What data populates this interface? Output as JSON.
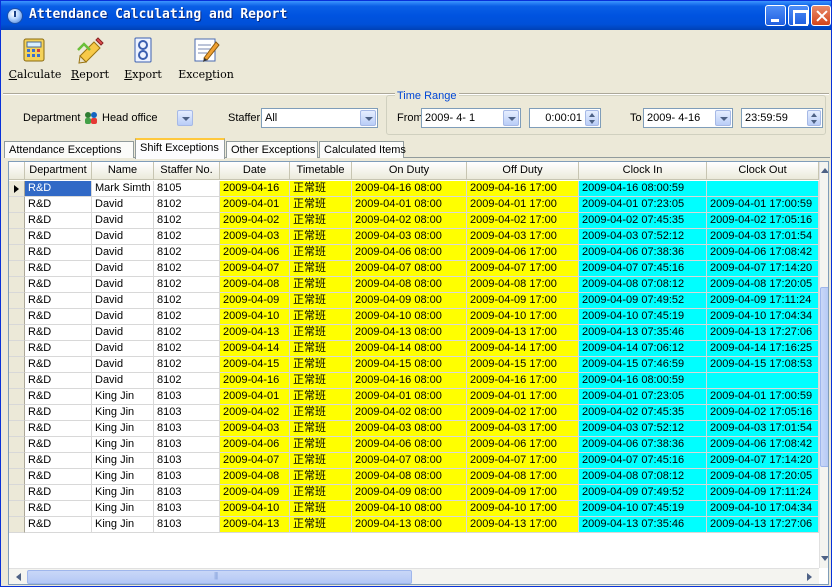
{
  "window": {
    "title": "Attendance Calculating and Report",
    "controls": [
      "minimize-icon",
      "maximize-icon",
      "close-icon"
    ]
  },
  "toolbar": {
    "calculate": {
      "label": "Calculate",
      "accel": "C",
      "rest": "alculate",
      "icon": "calculator-icon"
    },
    "report": {
      "label": "Report",
      "accel": "R",
      "rest": "eport",
      "icon": "report-icon"
    },
    "export": {
      "label": "Export",
      "accel": "E",
      "rest": "xport",
      "icon": "export-icon"
    },
    "exception": {
      "label": "Exception",
      "pre": "Exce",
      "accel": "p",
      "rest": "tion",
      "icon": "exception-icon"
    }
  },
  "filters": {
    "department_label": "Department",
    "department_value": "Head office",
    "staffer_label": "Staffer",
    "staffer_value": "All",
    "time_range_legend": "Time Range",
    "from_label": "From",
    "from_date": "2009- 4- 1",
    "from_time": "0:00:01",
    "to_label": "To",
    "to_date": "2009- 4-16",
    "to_time": "23:59:59"
  },
  "tabs": [
    {
      "label": "Attendance Exceptions",
      "active": false
    },
    {
      "label": "Shift Exceptions",
      "active": true
    },
    {
      "label": "Other Exceptions",
      "active": false
    },
    {
      "label": "Calculated Items",
      "active": false
    }
  ],
  "grid": {
    "columns": [
      "Department",
      "Name",
      "Staffer No.",
      "Date",
      "Timetable",
      "On Duty",
      "Off Duty",
      "Clock In",
      "Clock Out"
    ],
    "rows": [
      [
        "R&D",
        "Mark Simth",
        "8105",
        "2009-04-16",
        "正常班",
        "2009-04-16 08:00",
        "2009-04-16 17:00",
        "2009-04-16 08:00:59",
        ""
      ],
      [
        "R&D",
        "David",
        "8102",
        "2009-04-01",
        "正常班",
        "2009-04-01 08:00",
        "2009-04-01 17:00",
        "2009-04-01 07:23:05",
        "2009-04-01 17:00:59"
      ],
      [
        "R&D",
        "David",
        "8102",
        "2009-04-02",
        "正常班",
        "2009-04-02 08:00",
        "2009-04-02 17:00",
        "2009-04-02 07:45:35",
        "2009-04-02 17:05:16"
      ],
      [
        "R&D",
        "David",
        "8102",
        "2009-04-03",
        "正常班",
        "2009-04-03 08:00",
        "2009-04-03 17:00",
        "2009-04-03 07:52:12",
        "2009-04-03 17:01:54"
      ],
      [
        "R&D",
        "David",
        "8102",
        "2009-04-06",
        "正常班",
        "2009-04-06 08:00",
        "2009-04-06 17:00",
        "2009-04-06 07:38:36",
        "2009-04-06 17:08:42"
      ],
      [
        "R&D",
        "David",
        "8102",
        "2009-04-07",
        "正常班",
        "2009-04-07 08:00",
        "2009-04-07 17:00",
        "2009-04-07 07:45:16",
        "2009-04-07 17:14:20"
      ],
      [
        "R&D",
        "David",
        "8102",
        "2009-04-08",
        "正常班",
        "2009-04-08 08:00",
        "2009-04-08 17:00",
        "2009-04-08 07:08:12",
        "2009-04-08 17:20:05"
      ],
      [
        "R&D",
        "David",
        "8102",
        "2009-04-09",
        "正常班",
        "2009-04-09 08:00",
        "2009-04-09 17:00",
        "2009-04-09 07:49:52",
        "2009-04-09 17:11:24"
      ],
      [
        "R&D",
        "David",
        "8102",
        "2009-04-10",
        "正常班",
        "2009-04-10 08:00",
        "2009-04-10 17:00",
        "2009-04-10 07:45:19",
        "2009-04-10 17:04:34"
      ],
      [
        "R&D",
        "David",
        "8102",
        "2009-04-13",
        "正常班",
        "2009-04-13 08:00",
        "2009-04-13 17:00",
        "2009-04-13 07:35:46",
        "2009-04-13 17:27:06"
      ],
      [
        "R&D",
        "David",
        "8102",
        "2009-04-14",
        "正常班",
        "2009-04-14 08:00",
        "2009-04-14 17:00",
        "2009-04-14 07:06:12",
        "2009-04-14 17:16:25"
      ],
      [
        "R&D",
        "David",
        "8102",
        "2009-04-15",
        "正常班",
        "2009-04-15 08:00",
        "2009-04-15 17:00",
        "2009-04-15 07:46:59",
        "2009-04-15 17:08:53"
      ],
      [
        "R&D",
        "David",
        "8102",
        "2009-04-16",
        "正常班",
        "2009-04-16 08:00",
        "2009-04-16 17:00",
        "2009-04-16 08:00:59",
        ""
      ],
      [
        "R&D",
        "King Jin",
        "8103",
        "2009-04-01",
        "正常班",
        "2009-04-01 08:00",
        "2009-04-01 17:00",
        "2009-04-01 07:23:05",
        "2009-04-01 17:00:59"
      ],
      [
        "R&D",
        "King Jin",
        "8103",
        "2009-04-02",
        "正常班",
        "2009-04-02 08:00",
        "2009-04-02 17:00",
        "2009-04-02 07:45:35",
        "2009-04-02 17:05:16"
      ],
      [
        "R&D",
        "King Jin",
        "8103",
        "2009-04-03",
        "正常班",
        "2009-04-03 08:00",
        "2009-04-03 17:00",
        "2009-04-03 07:52:12",
        "2009-04-03 17:01:54"
      ],
      [
        "R&D",
        "King Jin",
        "8103",
        "2009-04-06",
        "正常班",
        "2009-04-06 08:00",
        "2009-04-06 17:00",
        "2009-04-06 07:38:36",
        "2009-04-06 17:08:42"
      ],
      [
        "R&D",
        "King Jin",
        "8103",
        "2009-04-07",
        "正常班",
        "2009-04-07 08:00",
        "2009-04-07 17:00",
        "2009-04-07 07:45:16",
        "2009-04-07 17:14:20"
      ],
      [
        "R&D",
        "King Jin",
        "8103",
        "2009-04-08",
        "正常班",
        "2009-04-08 08:00",
        "2009-04-08 17:00",
        "2009-04-08 07:08:12",
        "2009-04-08 17:20:05"
      ],
      [
        "R&D",
        "King Jin",
        "8103",
        "2009-04-09",
        "正常班",
        "2009-04-09 08:00",
        "2009-04-09 17:00",
        "2009-04-09 07:49:52",
        "2009-04-09 17:11:24"
      ],
      [
        "R&D",
        "King Jin",
        "8103",
        "2009-04-10",
        "正常班",
        "2009-04-10 08:00",
        "2009-04-10 17:00",
        "2009-04-10 07:45:19",
        "2009-04-10 17:04:34"
      ],
      [
        "R&D",
        "King Jin",
        "8103",
        "2009-04-13",
        "正常班",
        "2009-04-13 08:00",
        "2009-04-13 17:00",
        "2009-04-13 07:35:46",
        "2009-04-13 17:27:06"
      ]
    ],
    "selected_row": 0,
    "colors": {
      "duty_highlight": "#ffff00",
      "clock_highlight": "#00ffff",
      "selection": "#3169c6"
    }
  }
}
